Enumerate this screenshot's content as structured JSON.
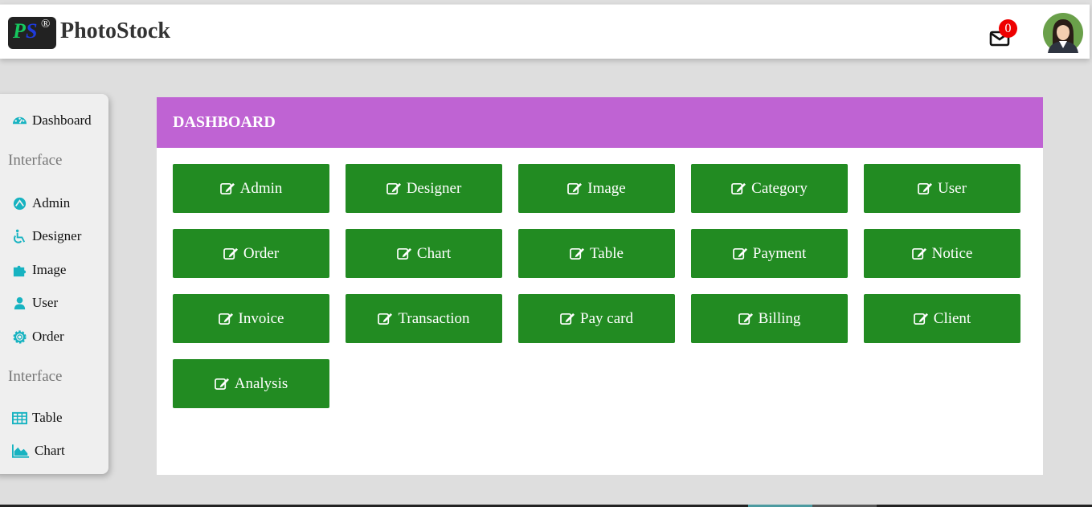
{
  "brand": {
    "logo_p": "P",
    "logo_s": "S",
    "logo_reg": "®",
    "name": "PhotoStock"
  },
  "header": {
    "notification_count": "0"
  },
  "sidebar": {
    "items": [
      {
        "label": "Dashboard",
        "icon": "dashboard-icon"
      },
      {
        "label": "Admin",
        "icon": "user-circle-icon"
      },
      {
        "label": "Designer",
        "icon": "wheelchair-icon"
      },
      {
        "label": "Image",
        "icon": "puzzle-icon"
      },
      {
        "label": "User",
        "icon": "user-icon"
      },
      {
        "label": "Order",
        "icon": "gear-icon"
      },
      {
        "label": "Table",
        "icon": "table-icon"
      },
      {
        "label": "Chart",
        "icon": "area-chart-icon"
      }
    ],
    "headings": [
      "Interface",
      "Interface"
    ]
  },
  "main": {
    "title": "DASHBOARD",
    "buttons": [
      "Admin",
      "Designer",
      "Image",
      "Category",
      "User",
      "Order",
      "Chart",
      "Table",
      "Payment",
      "Notice",
      "Invoice",
      "Transaction",
      "Pay card",
      "Billing",
      "Client",
      "Analysis"
    ]
  },
  "colors": {
    "accent_purple": "#bf63d3",
    "button_green": "#228b22",
    "icon_teal": "#17b3c1",
    "badge_red": "#ee0000"
  }
}
